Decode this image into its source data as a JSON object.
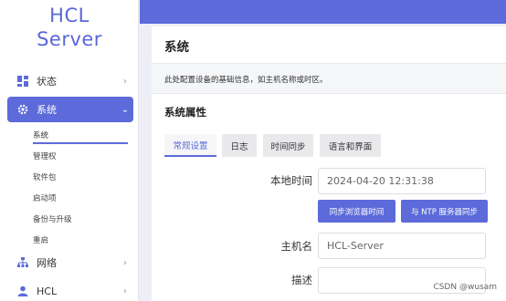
{
  "logo": {
    "line1": "HCL",
    "line2": "Server"
  },
  "sidebar": {
    "items": [
      {
        "label": "状态",
        "icon": "grid-icon"
      },
      {
        "label": "系统",
        "icon": "gear-icon"
      },
      {
        "label": "网络",
        "icon": "network-icon"
      },
      {
        "label": "HCL",
        "icon": "user-icon"
      }
    ],
    "submenu": [
      "系统",
      "管理权",
      "软件包",
      "启动项",
      "备份与升级",
      "重启"
    ]
  },
  "page": {
    "title": "系统",
    "description": "此处配置设备的基础信息，如主机名称或时区。",
    "section_title": "系统属性"
  },
  "tabs": [
    "常规设置",
    "日志",
    "时间同步",
    "语言和界面"
  ],
  "form": {
    "local_time_label": "本地时间",
    "local_time_value": "2024-04-20 12:31:38",
    "sync_browser_button": "同步浏览器时间",
    "sync_ntp_button": "与 NTP 服务器同步",
    "hostname_label": "主机名",
    "hostname_value": "HCL-Server",
    "description_label": "描述",
    "description_value": ""
  },
  "watermark": "CSDN @wusam",
  "colors": {
    "accent": "#5c6bd9",
    "logo": "#5a67d8"
  }
}
